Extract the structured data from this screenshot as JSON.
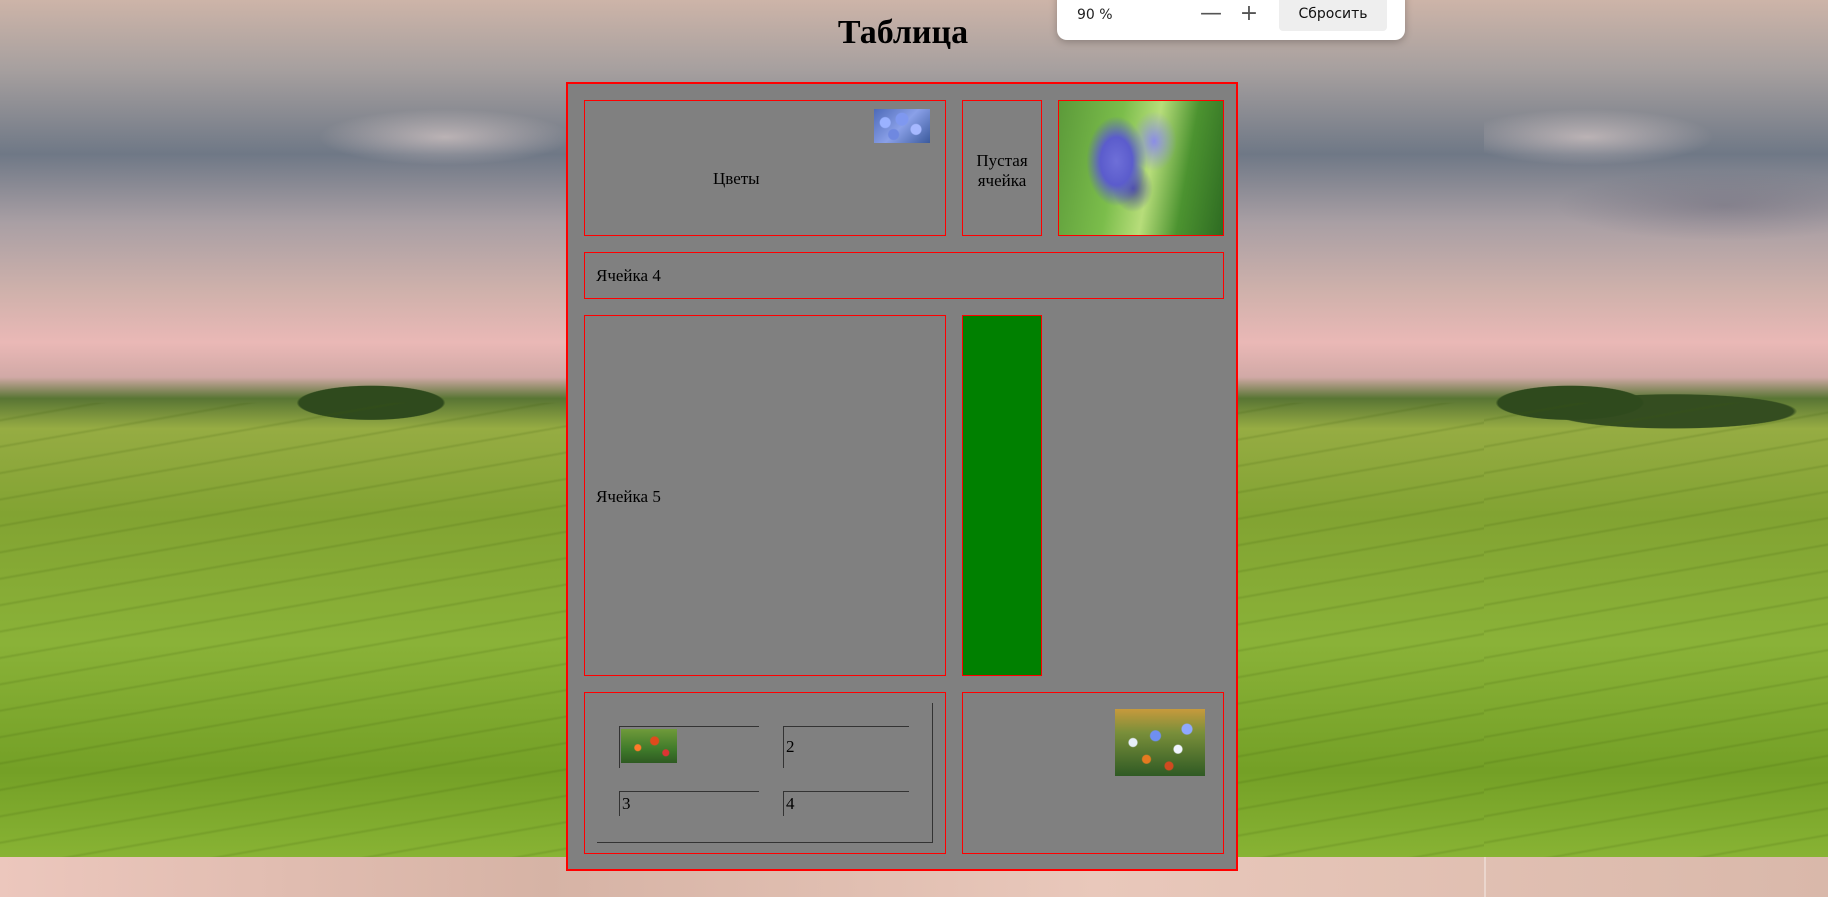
{
  "page": {
    "title": "Таблица"
  },
  "zoom_popup": {
    "level": "90 %",
    "minus_icon": "minus-icon",
    "plus_icon": "plus-icon",
    "reset_label": "Сбросить"
  },
  "table": {
    "flowers_label": "Цветы",
    "empty_cell_label": "Пустая ячейка",
    "cell4_label": "Ячейка 4",
    "cell5_label": "Ячейка 5",
    "nested": {
      "cell2": "2",
      "cell3": "3",
      "cell4": "4"
    },
    "colors": {
      "cell_background": "#808080",
      "border": "#ff0000",
      "green_cell": "#008000"
    }
  }
}
